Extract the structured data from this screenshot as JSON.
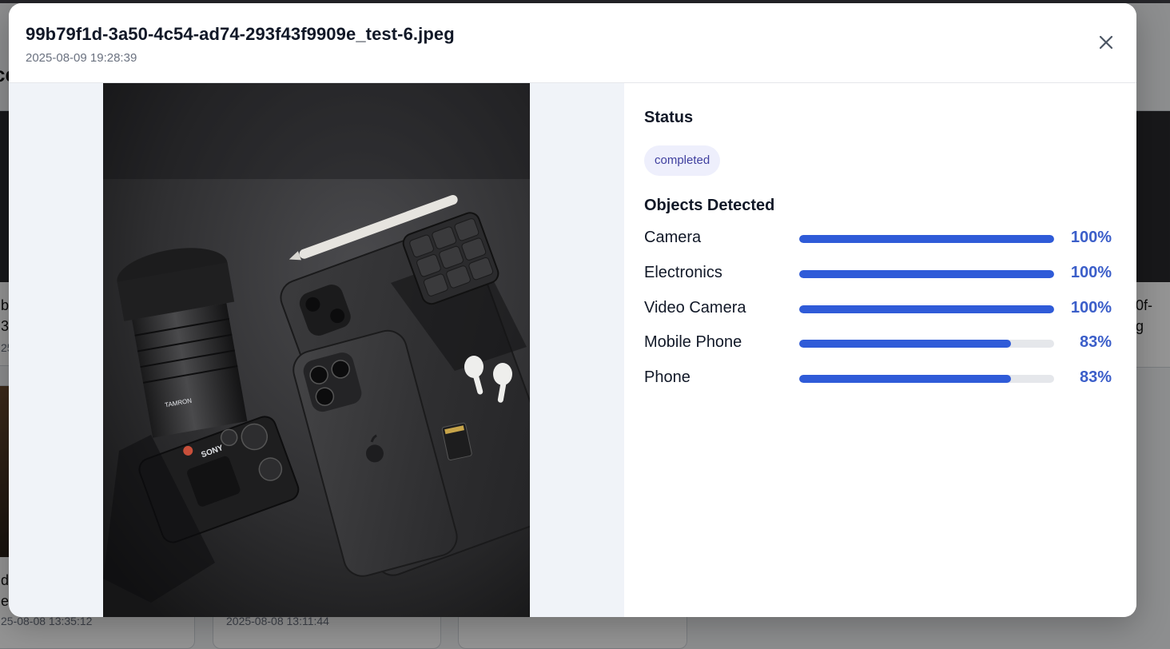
{
  "background": {
    "title_fragment": "ce",
    "cards": [
      {
        "name_lines": [
          "b",
          "3"
        ],
        "date": "25"
      },
      {
        "name_lines": [
          "0f-",
          "g"
        ],
        "date": ""
      },
      {
        "name_lines": [
          "d",
          "e"
        ],
        "date": "25-08-08 13:35:12"
      },
      {
        "name_lines": [
          "",
          ""
        ],
        "date": "2025-08-08 13:11:44"
      }
    ]
  },
  "modal": {
    "title": "99b79f1d-3a50-4c54-ad74-293f43f9909e_test-6.jpeg",
    "timestamp": "2025-08-09 19:28:39",
    "close_icon": "close-icon",
    "image": {
      "description_icon": "photo",
      "overlay_texts": {
        "lens_brand": "TAMRON",
        "camera_brand": "SONY"
      }
    },
    "status": {
      "heading": "Status",
      "value": "completed"
    },
    "objects": {
      "heading": "Objects Detected",
      "items": [
        {
          "label": "Camera",
          "confidence": 1.0,
          "percent_text": "100%"
        },
        {
          "label": "Electronics",
          "confidence": 1.0,
          "percent_text": "100%"
        },
        {
          "label": "Video Camera",
          "confidence": 1.0,
          "percent_text": "100%"
        },
        {
          "label": "Mobile Phone",
          "confidence": 0.83,
          "percent_text": "83%"
        },
        {
          "label": "Phone",
          "confidence": 0.83,
          "percent_text": "83%"
        }
      ]
    }
  },
  "colors": {
    "accent": "#2f5bd8",
    "percent_text": "#3b5ec9",
    "badge_bg": "#eeeffc",
    "badge_text": "#3f3f9f"
  }
}
